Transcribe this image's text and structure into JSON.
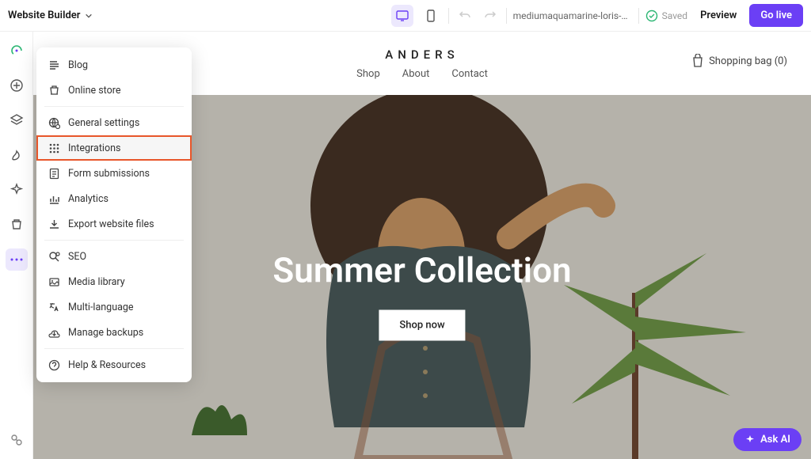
{
  "topbar": {
    "appSwitcher": "Website Builder",
    "url": "mediumaquamarine-loris-m...",
    "savedLabel": "Saved",
    "previewLabel": "Preview",
    "goLiveLabel": "Go live"
  },
  "dropdown": {
    "items": [
      {
        "label": "Blog",
        "icon": "blog-icon"
      },
      {
        "label": "Online store",
        "icon": "store-icon"
      },
      {
        "label": "General settings",
        "icon": "globe-settings-icon"
      },
      {
        "label": "Integrations",
        "icon": "grid-icon",
        "highlighted": true
      },
      {
        "label": "Form submissions",
        "icon": "form-icon"
      },
      {
        "label": "Analytics",
        "icon": "analytics-icon"
      },
      {
        "label": "Export website files",
        "icon": "download-icon"
      },
      {
        "label": "SEO",
        "icon": "seo-icon"
      },
      {
        "label": "Media library",
        "icon": "media-icon"
      },
      {
        "label": "Multi-language",
        "icon": "language-icon"
      },
      {
        "label": "Manage backups",
        "icon": "backup-icon"
      },
      {
        "label": "Help & Resources",
        "icon": "help-icon"
      }
    ]
  },
  "site": {
    "brand": "ANDERS",
    "nav": {
      "shop": "Shop",
      "about": "About",
      "contact": "Contact"
    },
    "bagLabel": "Shopping bag (0)",
    "heroTitle": "Summer Collection",
    "heroCta": "Shop now"
  },
  "askAi": "Ask AI"
}
